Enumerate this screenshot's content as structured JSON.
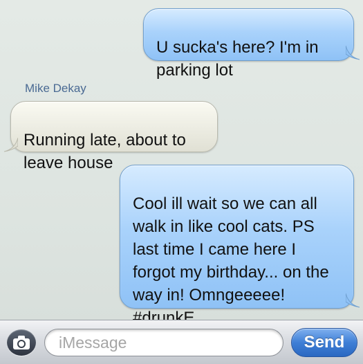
{
  "conversation": {
    "messages": [
      {
        "direction": "outgoing",
        "text": "U sucka's here? I'm in parking lot"
      },
      {
        "direction": "incoming",
        "sender": "Mike Dekay",
        "text": "Running late, about to leave house"
      },
      {
        "direction": "outgoing",
        "text": "Cool ill wait so we can all walk in like cool cats. PS last time I came here I forgot my birthday... on the way in! Omngeeeee! #drunkE"
      }
    ]
  },
  "composer": {
    "placeholder": "iMessage",
    "send_label": "Send",
    "camera_icon": "camera-icon"
  },
  "colors": {
    "outgoing_bubble": "#a9d2fb",
    "incoming_bubble": "#ecece2",
    "send_button": "#3f7fd6",
    "sender_name": "#4a6a93"
  }
}
